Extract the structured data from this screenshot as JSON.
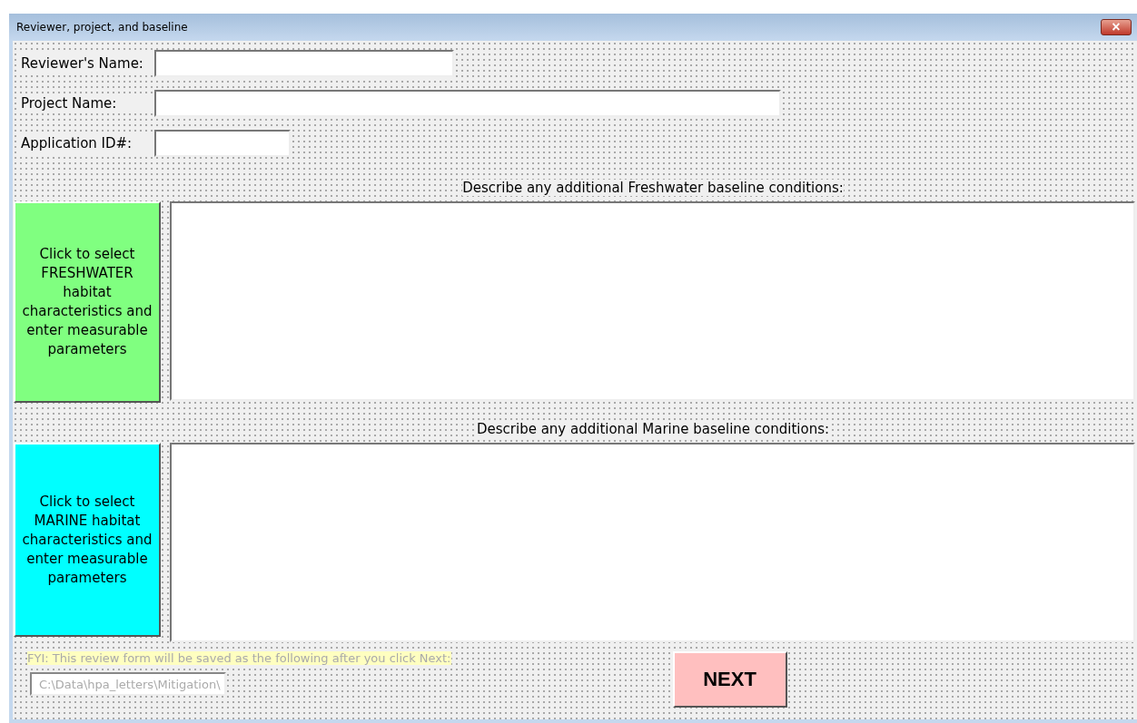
{
  "window": {
    "title": "Reviewer, project, and baseline",
    "close_button": "×"
  },
  "fields": [
    {
      "label": "Reviewer's Name:"
    },
    {
      "label": "Project Name:"
    },
    {
      "label": "Application ID#:"
    }
  ],
  "sections": [
    {
      "heading": "Describe any additional Freshwater baseline conditions:",
      "button": "Click to select FRESHWATER habitat characteristics and enter measurable parameters",
      "color": "#80ff80"
    },
    {
      "heading": "Describe any additional Marine baseline conditions:",
      "button": "Click to select MARINE habitat characteristics and enter measurable parameters",
      "color": "#00ffff"
    }
  ],
  "footer": {
    "note": "FYI: This review form will be saved as the following after you click Next:",
    "path": "C:\\Data\\hpa_letters\\Mitigation\\",
    "next_button": "NEXT"
  }
}
